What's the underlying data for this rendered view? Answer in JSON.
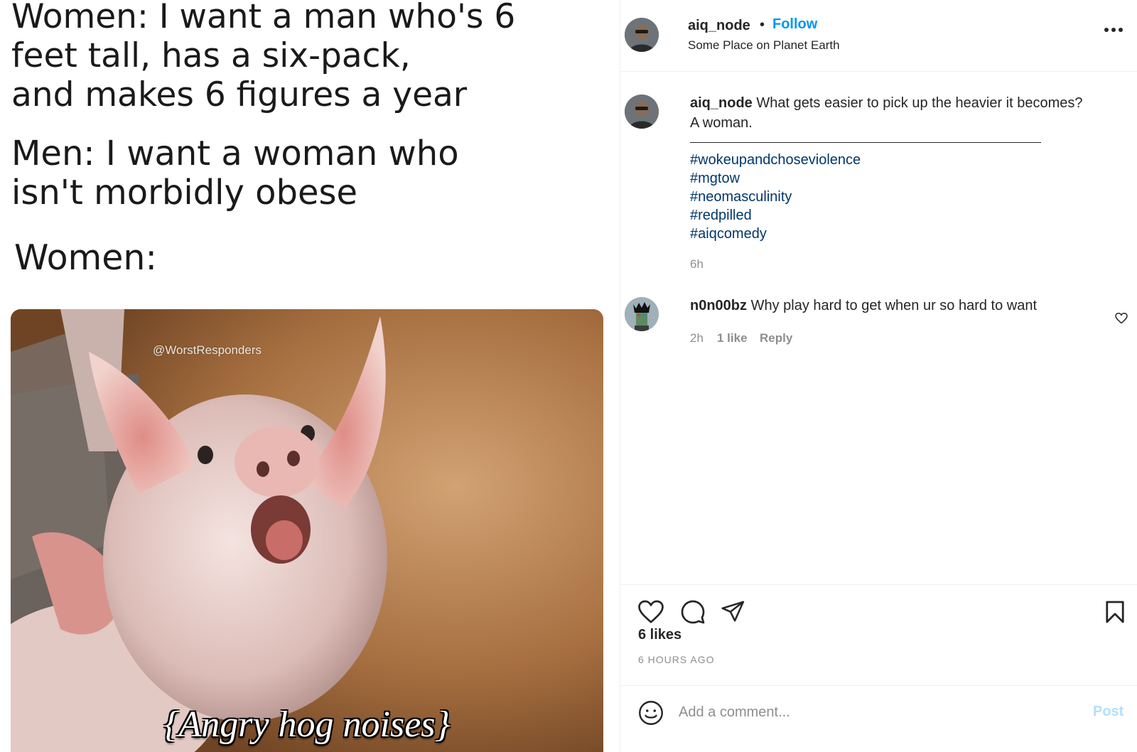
{
  "meme": {
    "line1": "Women: I want a man who's 6\nfeet tall, has a six-pack,\nand makes 6 figures a year",
    "line2": "Men: I want a woman who\nisn't morbidly obese",
    "line3": "Women:",
    "watermark": "@WorstResponders",
    "caption": "{Angry hog noises}"
  },
  "header": {
    "username": "aiq_node",
    "separator": "•",
    "follow_label": "Follow",
    "location": "Some Place on Planet Earth",
    "more_icon": "more-horizontal-icon"
  },
  "post_caption": {
    "username": "aiq_node",
    "text": "What gets easier to pick up the heavier it becomes?",
    "text2": "A woman.",
    "hashtags": [
      "#wokeupandchoseviolence",
      "#mgtow",
      "#neomasculinity",
      "#redpilled",
      "#aiqcomedy"
    ],
    "time": "6h"
  },
  "comments": [
    {
      "username": "n0n00bz",
      "text": "Why play hard to get when ur so hard to want",
      "time": "2h",
      "likes": "1 like",
      "reply_label": "Reply"
    }
  ],
  "actions": {
    "like_icon": "heart-icon",
    "comment_icon": "comment-icon",
    "share_icon": "paper-plane-icon",
    "save_icon": "bookmark-icon",
    "likes_text": "6 likes",
    "timestamp": "6 HOURS AGO"
  },
  "composer": {
    "emoji_icon": "smiley-icon",
    "placeholder": "Add a comment...",
    "post_label": "Post"
  },
  "colors": {
    "link_blue": "#0095f6",
    "hashtag": "#00376b",
    "muted": "#8e8e8e",
    "post_disabled": "#b2dffc"
  }
}
